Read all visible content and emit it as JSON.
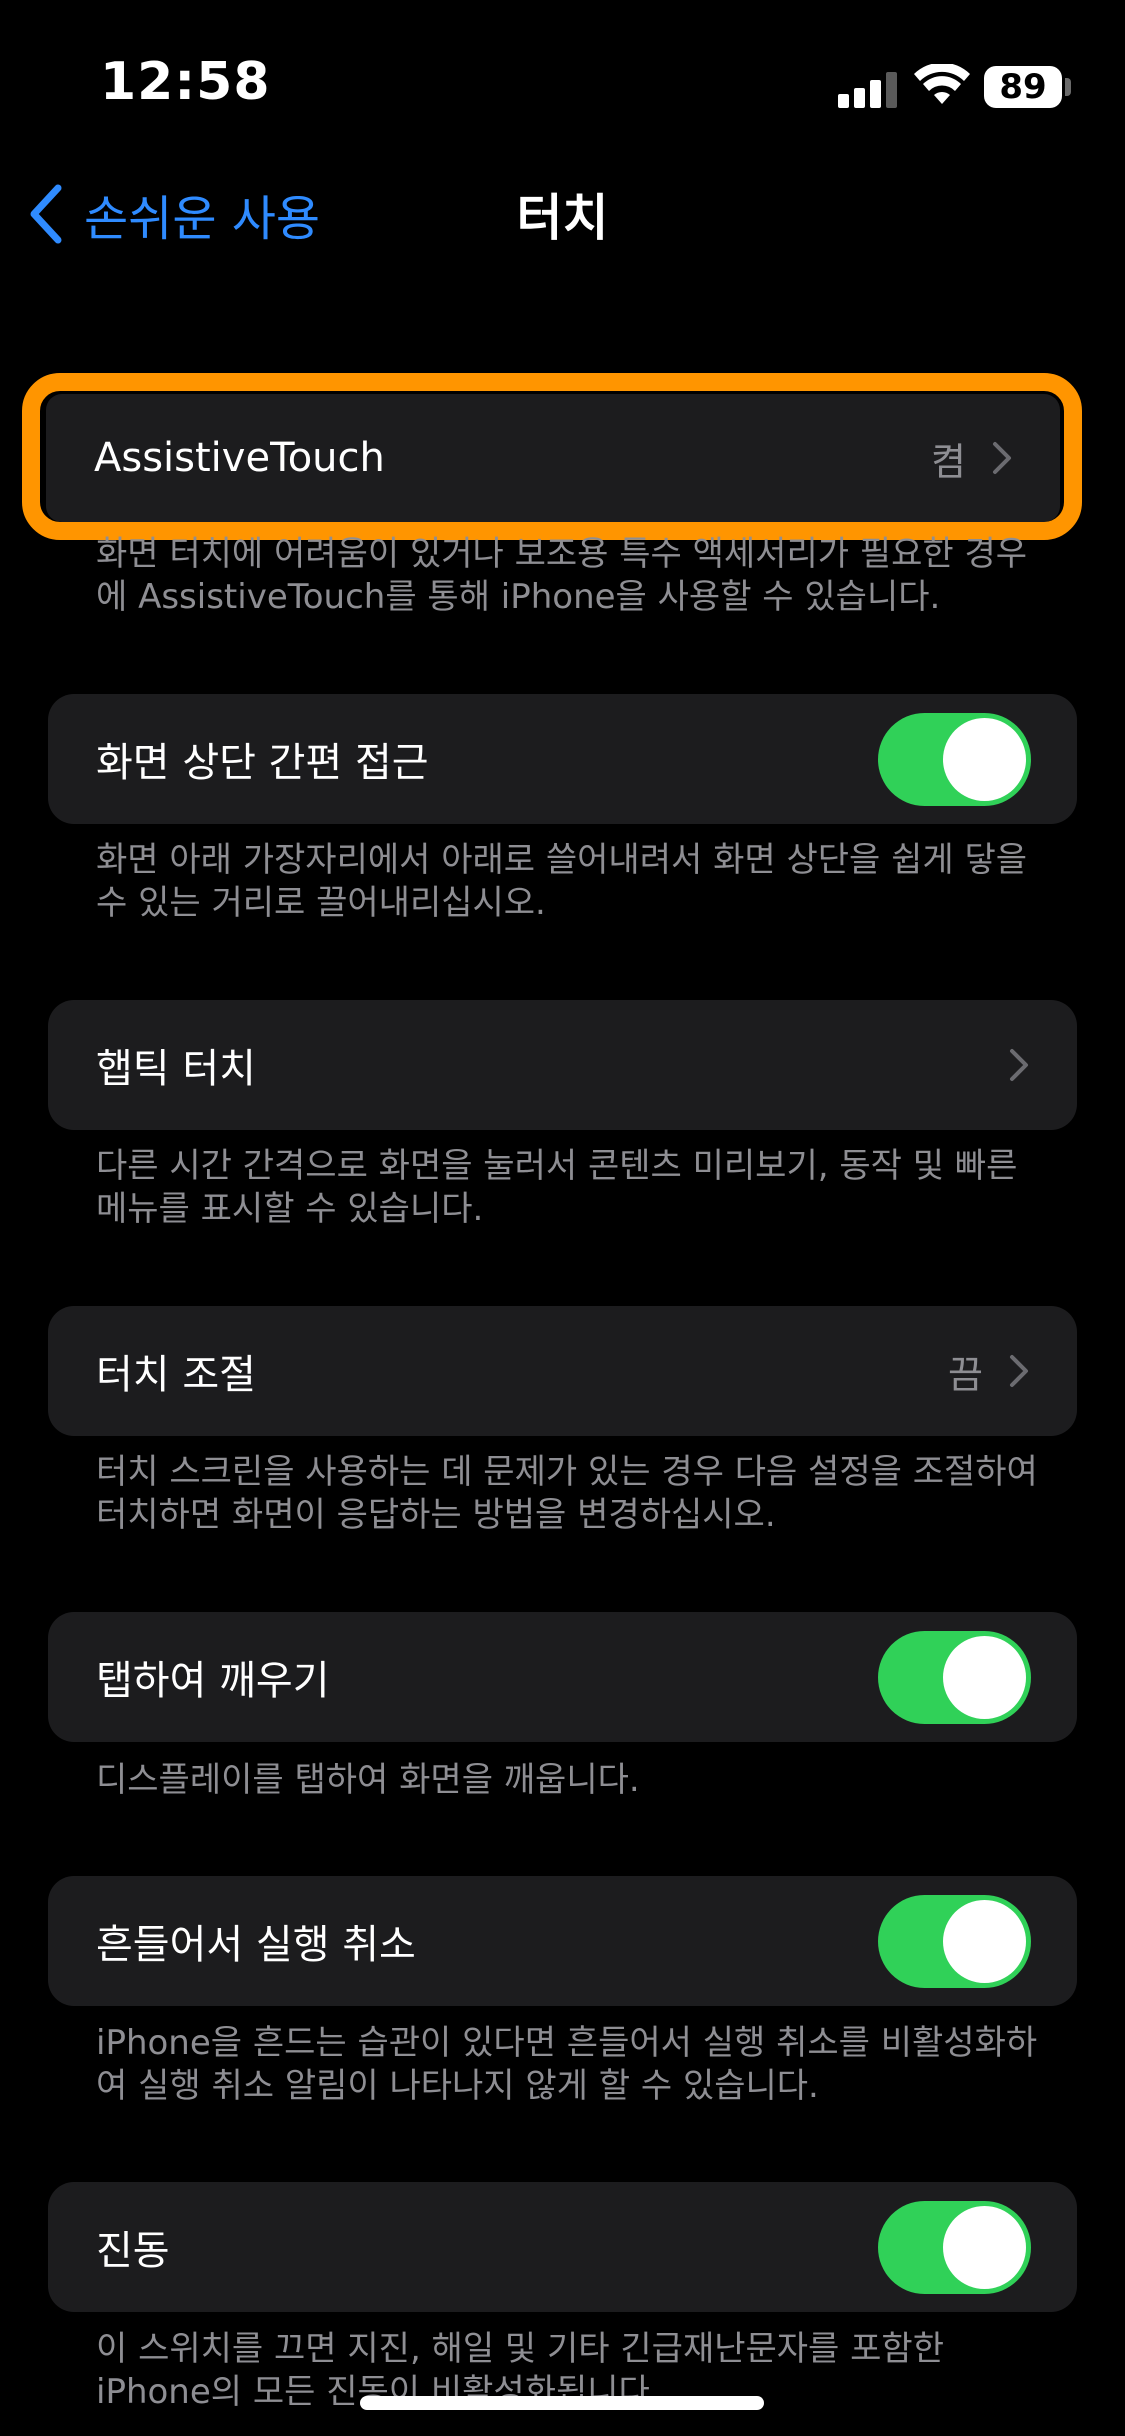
{
  "status_bar": {
    "time": "12:58",
    "battery": "89",
    "icons": [
      "cellular-signal-icon",
      "wifi-icon",
      "battery-icon"
    ]
  },
  "nav": {
    "back_label": "손쉬운 사용",
    "title": "터치",
    "accent_color": "#2f8bff"
  },
  "assistive_touch": {
    "label": "AssistiveTouch",
    "value": "켬",
    "footer": "화면 터치에 어려움이 있거나 보조용 특수 액세서리가 필요한 경우에 AssistiveTouch를 통해 iPhone을 사용할 수 있습니다.",
    "highlight_color": "#ff9500"
  },
  "reachability": {
    "label": "화면 상단 간편 접근",
    "on": true,
    "footer": "화면 아래 가장자리에서 아래로 쓸어내려서 화면 상단을 쉽게 닿을 수 있는 거리로 끌어내리십시오."
  },
  "haptic_touch": {
    "label": "햅틱 터치",
    "footer": "다른 시간 간격으로 화면을 눌러서 콘텐츠 미리보기, 동작 및 빠른 메뉴를 표시할 수 있습니다."
  },
  "touch_accommodations": {
    "label": "터치 조절",
    "value": "끔",
    "footer": "터치 스크린을 사용하는 데 문제가 있는 경우 다음 설정을 조절하여 터치하면 화면이 응답하는 방법을 변경하십시오."
  },
  "tap_to_wake": {
    "label": "탭하여 깨우기",
    "on": true,
    "footer": "디스플레이를 탭하여 화면을 깨웁니다."
  },
  "shake_to_undo": {
    "label": "흔들어서 실행 취소",
    "on": true,
    "footer": "iPhone을 흔드는 습관이 있다면 흔들어서 실행 취소를 비활성화하여 실행 취소 알림이 나타나지 않게 할 수 있습니다."
  },
  "vibration": {
    "label": "진동",
    "on": true,
    "footer": "이 스위치를 끄면 지진, 해일 및 기타 긴급재난문자를 포함한 iPhone의 모든 진동이 비활성화됩니다."
  },
  "colors": {
    "toggle_on": "#30d158",
    "cell_background": "#1c1c1e",
    "secondary_text": "#8e8e93"
  }
}
